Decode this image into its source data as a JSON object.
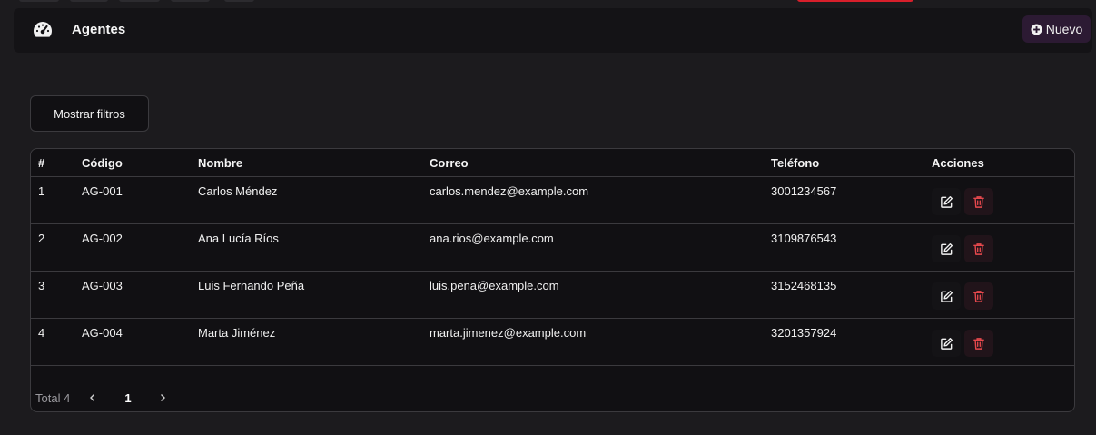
{
  "header": {
    "title": "Agentes",
    "new_button_label": "Nuevo",
    "icon": "gauge-icon"
  },
  "filters": {
    "toggle_label": "Mostrar filtros"
  },
  "table": {
    "columns": [
      "#",
      "Código",
      "Nombre",
      "Correo",
      "Teléfono",
      "Acciones"
    ],
    "rows": [
      {
        "num": "1",
        "code": "AG-001",
        "name": "Carlos Méndez",
        "email": "carlos.mendez@example.com",
        "phone": "3001234567"
      },
      {
        "num": "2",
        "code": "AG-002",
        "name": "Ana Lucía Ríos",
        "email": "ana.rios@example.com",
        "phone": "3109876543"
      },
      {
        "num": "3",
        "code": "AG-003",
        "name": "Luis Fernando Peña",
        "email": "luis.pena@example.com",
        "phone": "3152468135"
      },
      {
        "num": "4",
        "code": "AG-004",
        "name": "Marta Jiménez",
        "email": "marta.jimenez@example.com",
        "phone": "3201357924"
      }
    ]
  },
  "pagination": {
    "total_label": "Total 4",
    "prev_icon": "chevron-left-icon",
    "current_page": "1",
    "next_icon": "chevron-right-icon"
  },
  "colors": {
    "background": "#1c1b1e",
    "panel": "#111013",
    "header": "#141316",
    "accent_new": "#2c1a33",
    "danger": "#e5484d",
    "top_bar_red": "#d81f2b"
  }
}
